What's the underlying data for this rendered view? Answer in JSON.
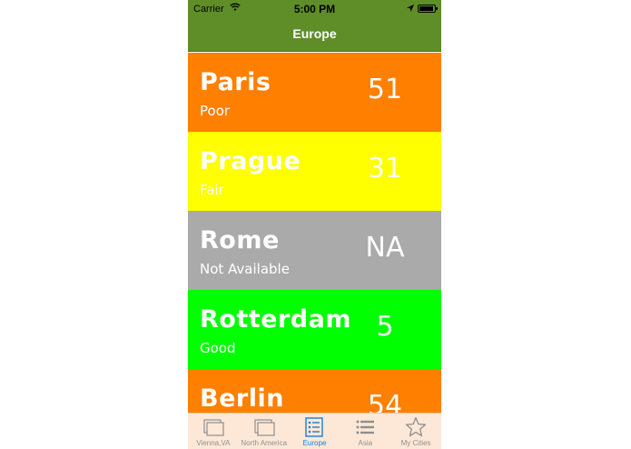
{
  "status_bar": {
    "carrier": "Carrier",
    "time": "5:00 PM"
  },
  "nav": {
    "title": "Europe"
  },
  "cities": [
    {
      "name": "Paris",
      "quality": "Poor",
      "aqi": "51",
      "color": "#ff7f00"
    },
    {
      "name": "Prague",
      "quality": "Fair",
      "aqi": "31",
      "color": "#ffff00"
    },
    {
      "name": "Rome",
      "quality": "Not Available",
      "aqi": "NA",
      "color": "#aaaaaa"
    },
    {
      "name": "Rotterdam",
      "quality": "Good",
      "aqi": "5",
      "color": "#00ff00"
    },
    {
      "name": "Berlin",
      "quality": "",
      "aqi": "54",
      "color": "#ff7f00"
    }
  ],
  "tabs": [
    {
      "label": "Vienna,VA",
      "icon": "stacked-windows-icon",
      "active": false
    },
    {
      "label": "North America",
      "icon": "stacked-windows-icon",
      "active": false
    },
    {
      "label": "Europe",
      "icon": "list-icon",
      "active": true
    },
    {
      "label": "Asia",
      "icon": "list-lines-icon",
      "active": false
    },
    {
      "label": "My Cities",
      "icon": "star-icon",
      "active": false
    }
  ],
  "colors": {
    "nav_background": "#5f8e28",
    "tab_background": "#fde8d8",
    "tab_active": "#1f7bd4",
    "tab_inactive": "#8e8e8e"
  }
}
